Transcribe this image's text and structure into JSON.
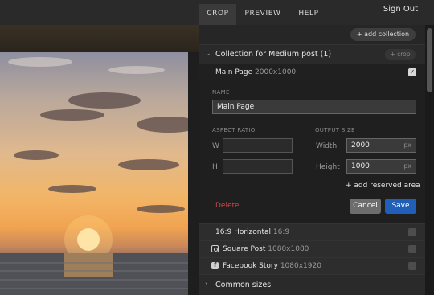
{
  "header": {
    "tabs": [
      {
        "label": "CROP",
        "active": true
      },
      {
        "label": "PREVIEW",
        "active": false
      },
      {
        "label": "HELP",
        "active": false
      }
    ],
    "sign_out": "Sign Out"
  },
  "panel": {
    "add_collection": "+ add collection",
    "collection": {
      "title": "Collection for Medium post (1)",
      "crop_button": "+ crop"
    },
    "main_item": {
      "name": "Main Page",
      "size": "2000x1000",
      "checked": true
    },
    "editor": {
      "name_label": "NAME",
      "name_value": "Main Page",
      "aspect_ratio_label": "ASPECT RATIO",
      "w_label": "W",
      "h_label": "H",
      "w_value": "",
      "h_value": "",
      "output_size_label": "OUTPUT SIZE",
      "width_label": "Width",
      "width_value": "2000",
      "height_label": "Height",
      "height_value": "1000",
      "unit": "px",
      "add_reserved_area": "+ add reserved area",
      "delete": "Delete",
      "cancel": "Cancel",
      "save": "Save"
    },
    "items": [
      {
        "name": "16:9 Horizontal",
        "size": "16:9",
        "icon": "none"
      },
      {
        "name": "Square Post",
        "size": "1080x1080",
        "icon": "instagram-icon"
      },
      {
        "name": "Facebook Story",
        "size": "1080x1920",
        "icon": "facebook-icon"
      }
    ],
    "common_sizes": "Common sizes"
  },
  "colors": {
    "save": "#1f5fb8",
    "delete": "#c24b4b",
    "background": "#262626"
  }
}
